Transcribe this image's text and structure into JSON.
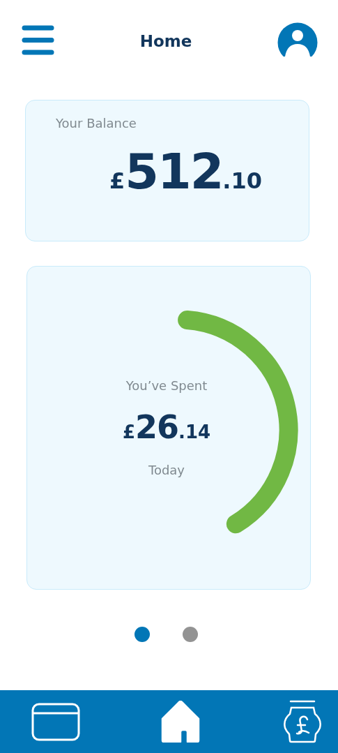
{
  "header": {
    "title": "Home"
  },
  "balance": {
    "label": "Your Balance",
    "currency": "£",
    "whole": "512",
    "pence": ".10"
  },
  "spent": {
    "label": "You’ve Spent",
    "currency": "£",
    "whole": "26",
    "pence": ".14",
    "period": "Today"
  },
  "pager": [
    {
      "selected": true
    },
    {
      "selected": false
    }
  ],
  "nav": [
    {
      "kind": "card",
      "selected": false
    },
    {
      "kind": "home",
      "selected": true
    },
    {
      "kind": "jar",
      "selected": false
    }
  ]
}
